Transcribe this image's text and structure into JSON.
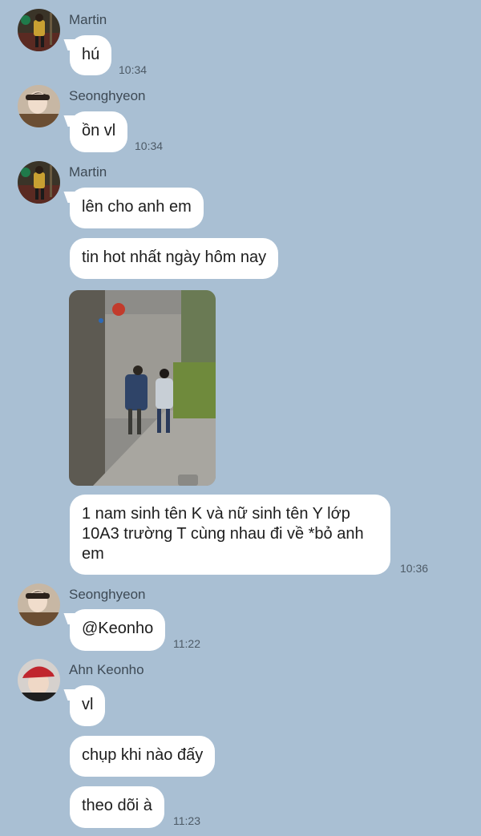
{
  "messages": [
    {
      "sender": "Martin",
      "text": "hú",
      "time": "10:34"
    },
    {
      "sender": "Seonghyeon",
      "text": "ồn vl",
      "time": "10:34"
    },
    {
      "sender": "Martin",
      "text": "lên cho anh em"
    },
    {
      "text": "tin hot nhất ngày hôm nay"
    },
    {
      "text": "1 nam sinh tên K và nữ sinh tên Y lớp 10A3 trường T cùng nhau đi về *bỏ anh em",
      "time": "10:36"
    },
    {
      "sender": "Seonghyeon",
      "text": "@Keonho",
      "time": "11:22"
    },
    {
      "sender": "Ahn Keonho",
      "text": "vl"
    },
    {
      "text": "chụp khi nào đấy"
    },
    {
      "text": "theo dõi à",
      "time": "11:23"
    }
  ],
  "colors": {
    "background": "#a9bfd3",
    "bubble": "#ffffff"
  }
}
